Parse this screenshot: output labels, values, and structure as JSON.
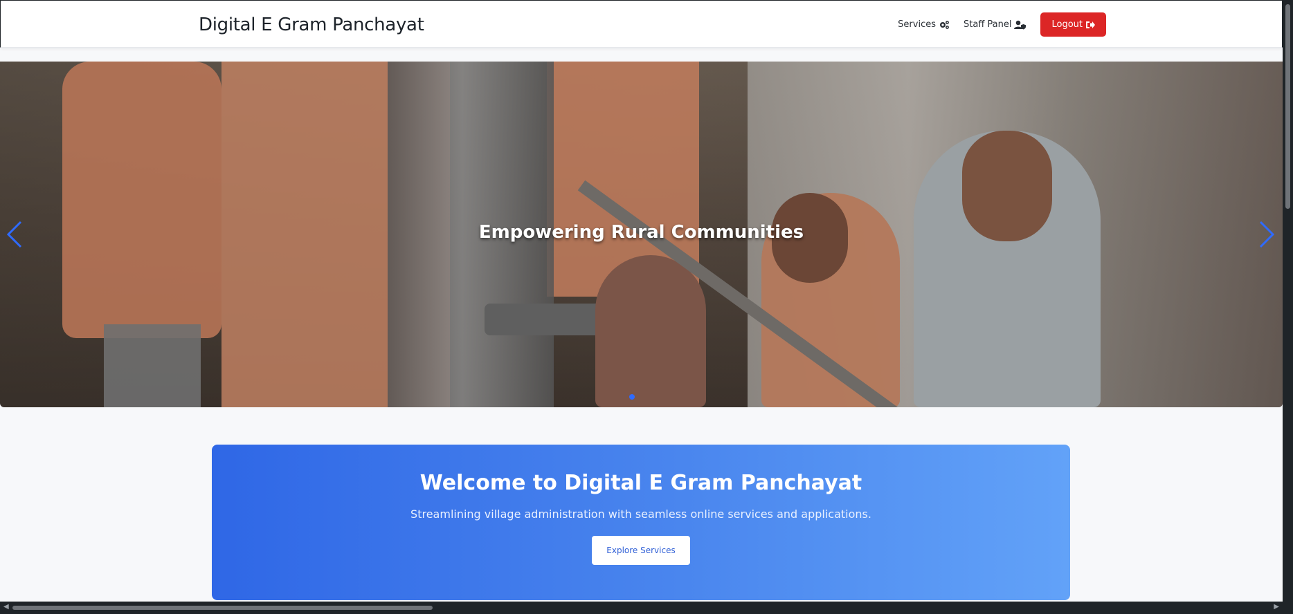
{
  "navbar": {
    "brand": "Digital E Gram Panchayat",
    "services_label": "Services",
    "staff_panel_label": "Staff Panel",
    "logout_label": "Logout"
  },
  "hero": {
    "caption": "Empowering Rural Communities",
    "active_slide": 1,
    "slide_count": 1
  },
  "welcome": {
    "title": "Welcome to Digital E Gram Panchayat",
    "subtitle": "Streamlining village administration with seamless online services and applications.",
    "button_label": "Explore Services"
  },
  "colors": {
    "logout": "#dc2626",
    "accent": "#2f67e6",
    "indicator": "#2f6bff"
  },
  "icons": {
    "services": "cogs-icon",
    "staff_panel": "user-shield-icon",
    "logout": "sign-out-icon",
    "prev": "chevron-left-icon",
    "next": "chevron-right-icon"
  }
}
